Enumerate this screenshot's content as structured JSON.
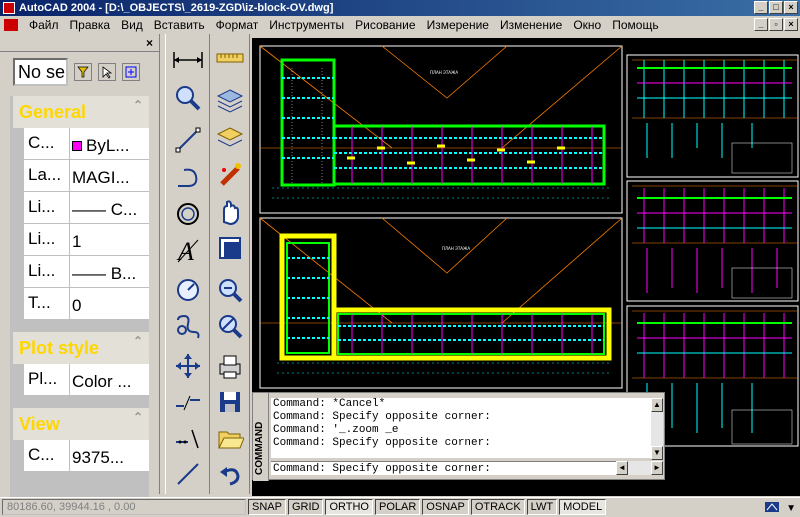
{
  "window": {
    "title": "AutoCAD 2004 - [D:\\_OBJECTS\\_2619-ZGD\\iz-block-OV.dwg]"
  },
  "menu": [
    "Файл",
    "Правка",
    "Вид",
    "Вставить",
    "Формат",
    "Инструменты",
    "Рисование",
    "Измерение",
    "Изменение",
    "Окно",
    "Помощь"
  ],
  "properties": {
    "selection": "No se",
    "general": {
      "title": "General",
      "rows": [
        {
          "key": "C...",
          "value": "ByL..."
        },
        {
          "key": "La...",
          "value": "MAGI..."
        },
        {
          "key": "Li...",
          "value": "—— C..."
        },
        {
          "key": "Li...",
          "value": "1"
        },
        {
          "key": "Li...",
          "value": "—— B..."
        },
        {
          "key": "T...",
          "value": "0"
        }
      ]
    },
    "plot_style": {
      "title": "Plot style",
      "rows": [
        {
          "key": "Pl...",
          "value": "Color ..."
        }
      ]
    },
    "view": {
      "title": "View",
      "rows": [
        {
          "key": "C...",
          "value": "9375..."
        }
      ]
    }
  },
  "command": {
    "side_label": "COMMAND",
    "history": [
      "Command: *Cancel*",
      "Command: Specify opposite corner:",
      "Command: '_.zoom _e",
      "Command: Specify opposite corner:"
    ],
    "current": "Command: Specify opposite corner:"
  },
  "drawing": {
    "sheet_title_1": "ПЛАН ЭТАЖА",
    "sheet_title_2": "ПЛАН ЭТАЖА"
  },
  "status": {
    "coords": "80186.60, 39944.16 , 0.00",
    "toggles": [
      "SNAP",
      "GRID",
      "ORTHO",
      "POLAR",
      "OSNAP",
      "OTRACK",
      "LWT",
      "MODEL"
    ]
  },
  "colors": {
    "title_bar": "#0a246a",
    "section_title": "#ffd700",
    "drawing_bg": "#000000",
    "cyan": "#00ffff",
    "green": "#00ff00",
    "yellow": "#ffff00",
    "magenta": "#ff00ff"
  },
  "icons": [
    "autocad-app-icon",
    "minimize-icon",
    "maximize-icon",
    "close-icon",
    "quick-select-icon",
    "select-objects-icon",
    "pickadd-icon",
    "line-icon",
    "polyline-icon",
    "circle-icon",
    "text-icon",
    "arc-icon",
    "move-icon",
    "layers-icon",
    "zoom-icon",
    "pan-icon",
    "print-icon",
    "save-icon",
    "open-icon",
    "undo-icon"
  ]
}
